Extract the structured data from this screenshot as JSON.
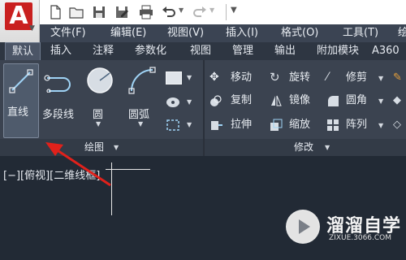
{
  "app": {
    "logo_letter": "A",
    "logo_color": "#c9201f"
  },
  "quick_access": [
    "new-icon",
    "open-icon",
    "save-icon",
    "saveas-icon",
    "print-icon",
    "undo-icon",
    "redo-icon",
    "customize-icon"
  ],
  "menu": [
    "文件(F)",
    "编辑(E)",
    "视图(V)",
    "插入(I)",
    "格式(O)",
    "工具(T)",
    "绘"
  ],
  "tabs": [
    "默认",
    "插入",
    "注释",
    "参数化",
    "视图",
    "管理",
    "输出",
    "附加模块",
    "A360"
  ],
  "ribbon": {
    "draw": {
      "tools": [
        "直线",
        "多段线",
        "圆",
        "圆弧"
      ],
      "panel_title": "绘图"
    },
    "modify": {
      "col1": [
        "移动",
        "复制",
        "拉伸"
      ],
      "col2": [
        "旋转",
        "镜像",
        "缩放"
      ],
      "col3": [
        "修剪",
        "圆角",
        "阵列"
      ],
      "panel_title": "修改"
    }
  },
  "canvas": {
    "viewport_label": "[−][俯视][二维线框]"
  },
  "watermark": {
    "title": "溜溜自学",
    "url": "ZIXUE.3066.COM"
  },
  "colors": {
    "accent_arrow": "#e0211b",
    "canvas_bg": "#222a35",
    "ribbon_bg": "#3b4350"
  }
}
